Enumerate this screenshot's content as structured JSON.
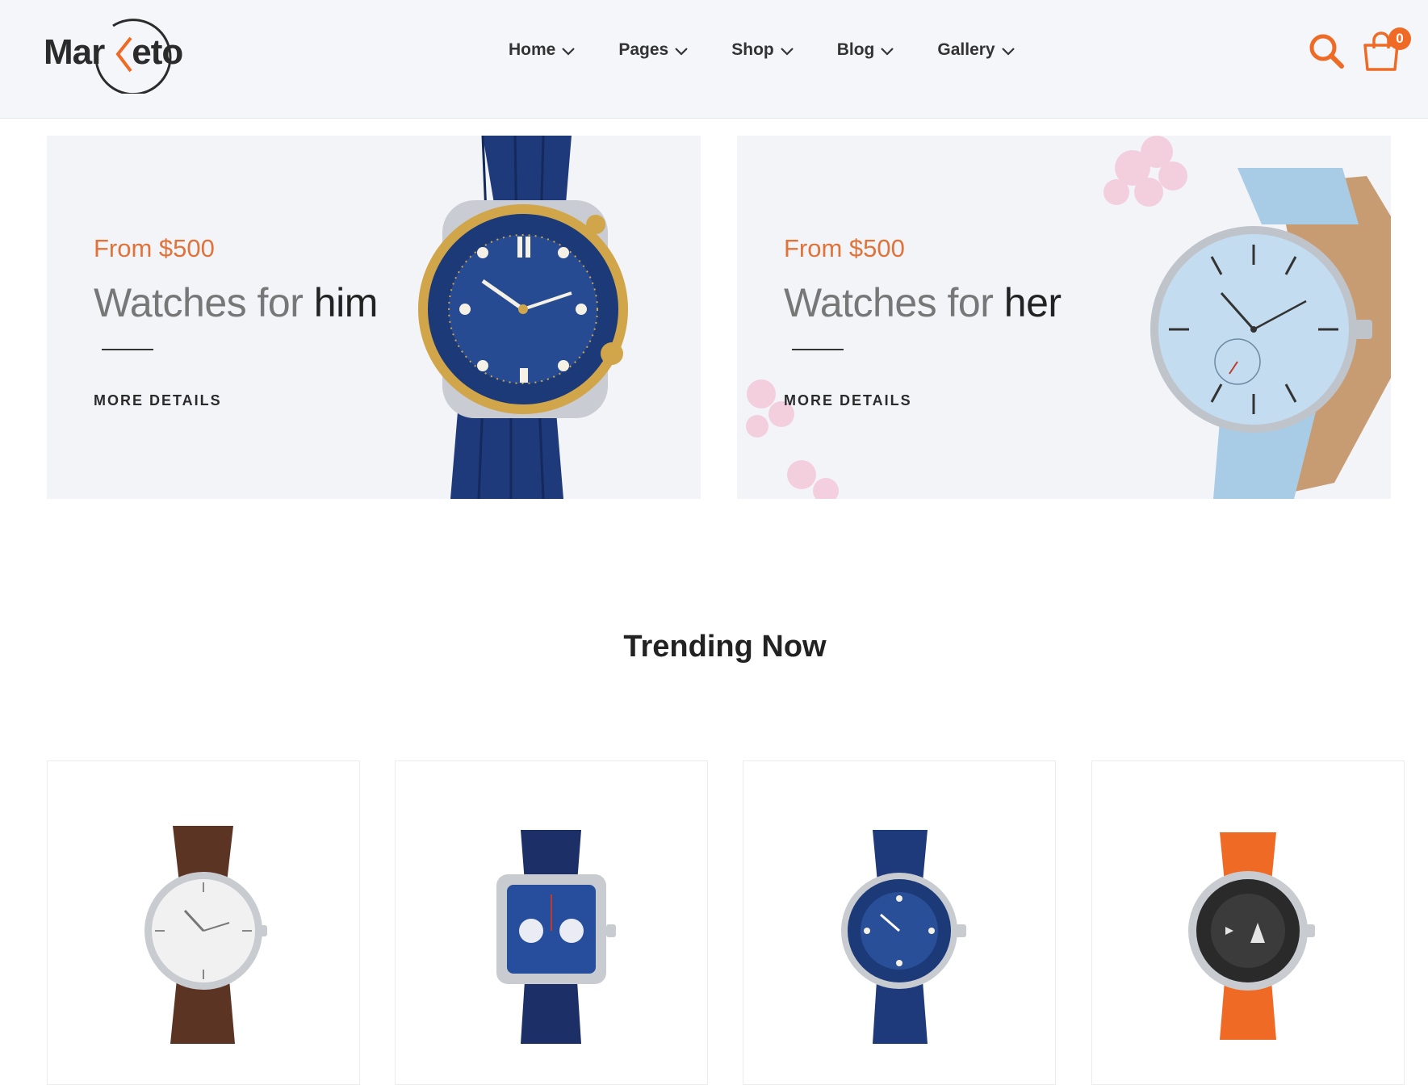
{
  "brand": {
    "name": "Marketo",
    "logo_left": "Mar",
    "logo_right": "eto"
  },
  "nav": {
    "items": [
      {
        "label": "Home"
      },
      {
        "label": "Pages"
      },
      {
        "label": "Shop"
      },
      {
        "label": "Blog"
      },
      {
        "label": "Gallery"
      }
    ]
  },
  "header": {
    "search_icon": "search-icon",
    "cart_icon": "shopping-bag-icon",
    "cart_count": "0"
  },
  "banners": [
    {
      "price": "From $500",
      "title_light": "Watches for ",
      "title_bold": "him",
      "cta": "MORE DETAILS"
    },
    {
      "price": "From $500",
      "title_light": "Watches for ",
      "title_bold": "her",
      "cta": "MORE DETAILS"
    }
  ],
  "trending": {
    "title": "Trending Now"
  },
  "colors": {
    "accent": "#ee6a25",
    "header_bg": "#f5f6fa",
    "banner_bg": "#f3f4f8",
    "text_dark": "#222222"
  }
}
